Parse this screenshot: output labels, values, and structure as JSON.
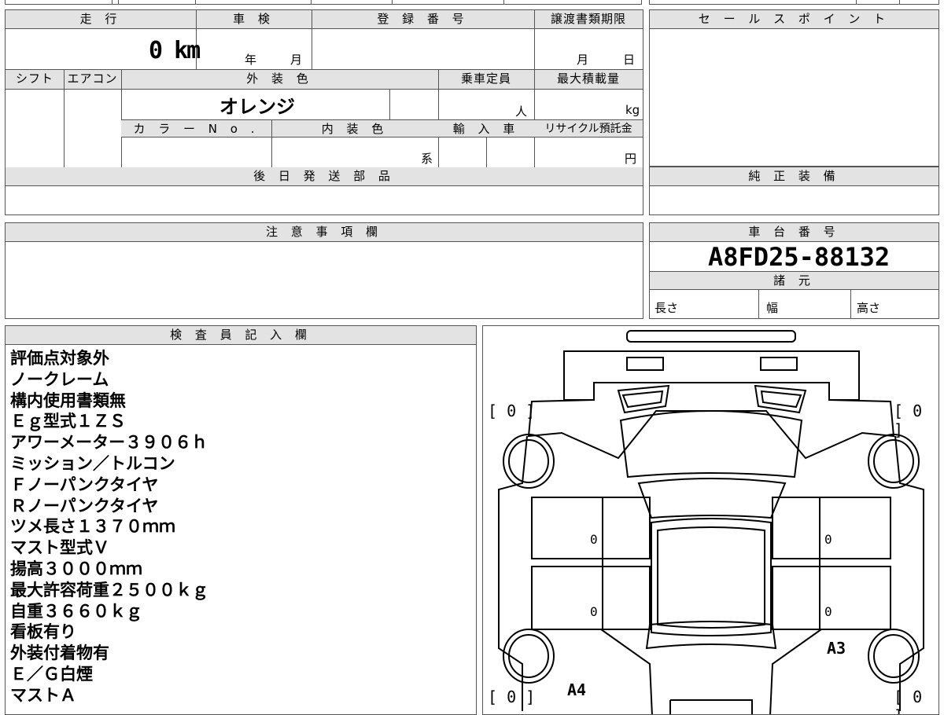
{
  "top_left": {
    "mileage": {
      "header": "走 行",
      "value": "0 km"
    },
    "inspection": {
      "header": "車 検",
      "year_label": "年",
      "month_label": "月"
    },
    "registration": {
      "header": "登 録 番 号"
    },
    "transfer_deadline": {
      "header": "譲渡書類期限",
      "month_label": "月",
      "day_label": "日"
    },
    "shift": {
      "header": "シフト"
    },
    "aircon": {
      "header": "エアコン"
    },
    "exterior_color": {
      "header": "外 装 色",
      "value": "オレンジ"
    },
    "capacity": {
      "header": "乗車定員",
      "unit": "人"
    },
    "max_load": {
      "header": "最大積載量",
      "unit": "kg"
    },
    "color_no": {
      "header": "カ ラ ー N o ."
    },
    "interior_color": {
      "header": "内 装 色",
      "unit": "系"
    },
    "import": {
      "header": "輸 入 車"
    },
    "recycle": {
      "header": "リサイクル預託金",
      "unit": "円"
    },
    "later_parts": {
      "header": "後 日 発 送 部 品"
    }
  },
  "sales_point": {
    "header": "セ ー ル ス ポ イ ン ト"
  },
  "genuine_equipment": {
    "header": "純 正 装 備"
  },
  "notes": {
    "header": "注 意 事 項 欄"
  },
  "chassis": {
    "header": "車 台 番 号",
    "value": "A8FD25-88132"
  },
  "specs": {
    "header": "諸 元",
    "length": "長さ",
    "width": "幅",
    "height": "高さ"
  },
  "inspector": {
    "header": "検 査 員 記 入 欄",
    "lines": [
      "評価点対象外",
      "ノークレーム",
      "構内使用書類無",
      "Ｅｇ型式１ＺＳ",
      "アワーメーター３９０６ｈ",
      "ミッション／トルコン",
      "Ｆノーパンクタイヤ",
      "Ｒノーパンクタイヤ",
      "ツメ長さ１３７０ｍｍ",
      "マスト型式Ｖ",
      "揚高３０００ｍｍ",
      "最大許容荷重２５００ｋｇ",
      "自重３６６０ｋｇ",
      "看板有り",
      "外装付着物有",
      "Ｅ／Ｇ白煙",
      "マストＡ"
    ]
  },
  "diagram": {
    "tire_fl": "[ 0 ]",
    "tire_fr": "[ 0 ]",
    "tire_rl": "[ 0 ]",
    "tire_rr": "[ 0 ]",
    "door_fl": "0",
    "door_fr": "0",
    "door_rl": "0",
    "door_rr": "0",
    "mark_a3": "A3",
    "mark_a4": "A4"
  }
}
